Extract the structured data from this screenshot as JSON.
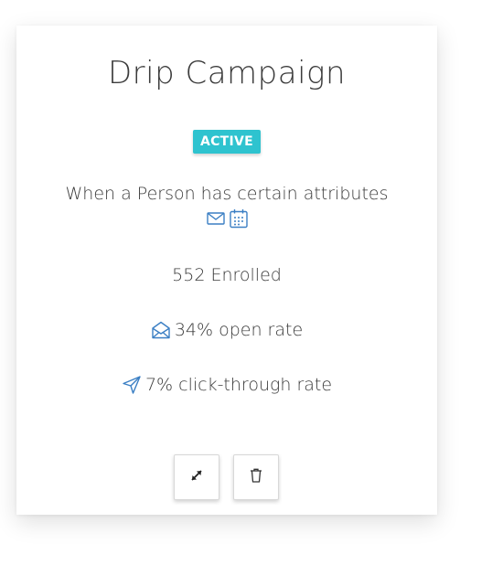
{
  "card": {
    "title": "Drip Campaign",
    "status": "ACTIVE",
    "trigger": "When a Person has certain attributes",
    "trigger_icons": [
      "envelope-icon",
      "calendar-icon"
    ],
    "enrolled": "552 Enrolled",
    "open_rate": "34% open rate",
    "click_rate": "7% click-through rate",
    "actions": [
      "expand-icon",
      "trash-icon"
    ]
  },
  "colors": {
    "badge": "#2ec3cf",
    "icon_blue": "#3b7fc4",
    "text": "#3a3a3a"
  }
}
